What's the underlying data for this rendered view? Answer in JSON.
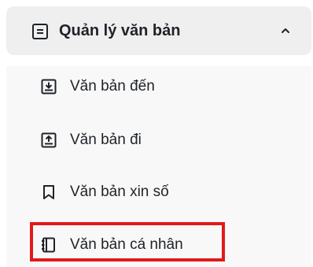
{
  "menu": {
    "group": {
      "label": "Quản lý văn bản",
      "icon": "document-icon",
      "expanded": true,
      "chevron": "chevron-up-icon"
    },
    "items": [
      {
        "label": "Văn bản đến",
        "icon": "inbox-download-icon"
      },
      {
        "label": "Văn bản đi",
        "icon": "outbox-upload-icon"
      },
      {
        "label": "Văn bản xin số",
        "icon": "bookmark-icon"
      },
      {
        "label": "Văn bản cá nhân",
        "icon": "notebook-icon",
        "highlighted": true
      }
    ]
  },
  "colors": {
    "header_bg": "#efefef",
    "panel_bg": "#f8f8f8",
    "text": "#1f2328",
    "highlight": "#e0191b"
  }
}
